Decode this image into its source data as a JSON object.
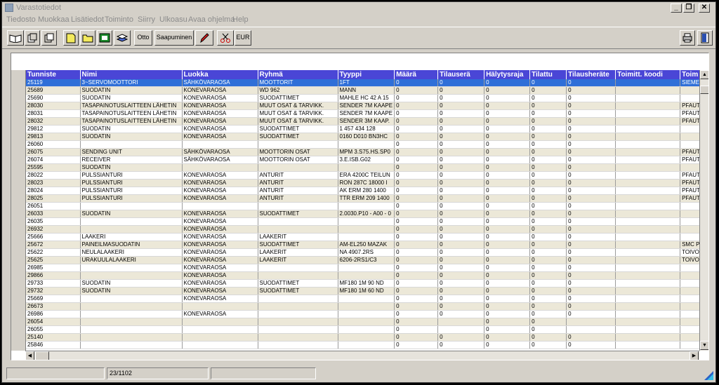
{
  "window": {
    "title": "Varastotiedot"
  },
  "title_buttons": [
    "minimize",
    "restore",
    "close"
  ],
  "menu": [
    "Tiedosto",
    "Muokkaa",
    "Lisätiedot",
    "Toiminto",
    "Siirry",
    "Ulkoasu",
    "Avaa ohjelma",
    "Help"
  ],
  "toolbar": {
    "otto_label": "Otto",
    "saapuminen_label": "Saapuminen",
    "eur_label": "EUR",
    "icons": [
      "open-book-icon",
      "copy-record-icon",
      "paste-record-icon",
      "yellow-folder-icon",
      "open-folder-icon",
      "green-chart-icon",
      "stacked-books-icon",
      "pencil-icon",
      "scissors-icon",
      "printer-icon",
      "exit-door-icon"
    ]
  },
  "grid": {
    "columns": [
      "Tunniste",
      "Nimi",
      "Luokka",
      "Ryhmä",
      "Tyyppi",
      "Määrä",
      "Tilauserä",
      "Hälytysraja",
      "Tilattu",
      "Tilausheräte",
      "Toimitt. koodi",
      "Toim"
    ],
    "selected_row": 0,
    "rows": [
      [
        "25119",
        "3~SERVOMOOTTORI",
        "SÄHKÖVARAOSA",
        "MOOTTORIT",
        "1FT",
        "0",
        "0",
        "0",
        "0",
        "0",
        "",
        "SIEMEN"
      ],
      [
        "25689",
        "SUODATIN",
        "KONEVARAOSA",
        "WD 962",
        "MANN",
        "0",
        "0",
        "0",
        "0",
        "0",
        "",
        ""
      ],
      [
        "25690",
        "SUODATIN",
        "KONEVARAOSA",
        "SUODATTIMET",
        "MAHLE HC 42 A 15",
        "0",
        "0",
        "0",
        "0",
        "0",
        "",
        ""
      ],
      [
        "28030",
        "TASAPAINOTUSLAITTEEN LÄHETIN",
        "KONEVARAOSA",
        "MUUT OSAT & TARVIKK.",
        "SENDER 7M KAAPE",
        "0",
        "0",
        "0",
        "0",
        "0",
        "",
        "PFAUTE"
      ],
      [
        "28031",
        "TASAPAINOTUSLAITTEEN LÄHETIN",
        "KONEVARAOSA",
        "MUUT OSAT & TARVIKK.",
        "SENDER 7M KAAPE",
        "0",
        "0",
        "0",
        "0",
        "0",
        "",
        "PFAUTE"
      ],
      [
        "28032",
        "TASAPAINOTUSLAITTEEN LÄHETIN",
        "KONEVARAOSA",
        "MUUT OSAT & TARVIKK.",
        "SENDER 3M KAAP.",
        "0",
        "0",
        "0",
        "0",
        "0",
        "",
        "PFAUTE"
      ],
      [
        "29812",
        "SUODATIN",
        "KONEVARAOSA",
        "SUODATTIMET",
        "1 457 434 128",
        "0",
        "0",
        "0",
        "0",
        "0",
        "",
        ""
      ],
      [
        "29813",
        "SUODATIN",
        "KONEVARAOSA",
        "SUODATTIMET",
        "0160 D010 BN3HC",
        "0",
        "0",
        "0",
        "0",
        "0",
        "",
        ""
      ],
      [
        "26060",
        "",
        "",
        "",
        "",
        "0",
        "0",
        "0",
        "0",
        "0",
        "",
        ""
      ],
      [
        "26075",
        "SENDING UNIT",
        "SÄHKÖVARAOSA",
        "MOOTTORIN OSAT",
        "MPM 3.S75.HS.SP0",
        "0",
        "0",
        "0",
        "0",
        "0",
        "",
        "PFAUTE"
      ],
      [
        "26074",
        "RECEIVER",
        "SÄHKÖVARAOSA",
        "MOOTTORIN OSAT",
        "3.E.ISB.G02",
        "0",
        "0",
        "0",
        "0",
        "0",
        "",
        "PFAUTE"
      ],
      [
        "25595",
        "SUODATIN",
        "",
        "",
        "",
        "0",
        "0",
        "0",
        "0",
        "0",
        "",
        ""
      ],
      [
        "28022",
        "PULSSIANTURI",
        "KONEVARAOSA",
        "ANTURIT",
        "ERA 4200C TEILUN",
        "0",
        "0",
        "0",
        "0",
        "0",
        "",
        "PFAUTI"
      ],
      [
        "28023",
        "PULSSIANTURI",
        "KONEVARAOSA",
        "ANTURIT",
        "RON 287C 18000 I",
        "0",
        "0",
        "0",
        "0",
        "0",
        "",
        "PFAUTE"
      ],
      [
        "28024",
        "PULSSIANTURI",
        "KONEVARAOSA",
        "ANTURIT",
        "AK ERM 280 1400",
        "0",
        "0",
        "0",
        "0",
        "0",
        "",
        "PFAUTE"
      ],
      [
        "28025",
        "PULSSIANTURI",
        "KONEVARAOSA",
        "ANTURIT",
        "TTR ERM 209 1400",
        "0",
        "0",
        "0",
        "0",
        "0",
        "",
        "PFAUTE"
      ],
      [
        "26051",
        "",
        "",
        "",
        "",
        "0",
        "0",
        "0",
        "0",
        "0",
        "",
        ""
      ],
      [
        "26033",
        "SUODATIN",
        "KONEVARAOSA",
        "SUODATTIMET",
        "2.0030.P10 - A00 - 0",
        "0",
        "0",
        "0",
        "0",
        "0",
        "",
        ""
      ],
      [
        "26035",
        "",
        "KONEVARAOSA",
        "",
        "",
        "0",
        "0",
        "0",
        "0",
        "0",
        "",
        ""
      ],
      [
        "26932",
        "",
        "KONEVARAOSA",
        "",
        "",
        "0",
        "0",
        "0",
        "0",
        "0",
        "",
        ""
      ],
      [
        "25666",
        "LAAKERI",
        "KONEVARAOSA",
        "LAAKERIT",
        "",
        "0",
        "0",
        "0",
        "0",
        "0",
        "",
        ""
      ],
      [
        "25672",
        "PAINEILMASUODATIN",
        "KONEVARAOSA",
        "SUODATTIMET",
        "AM-EL250 MAZAK",
        "0",
        "0",
        "0",
        "0",
        "0",
        "",
        "SMC PN"
      ],
      [
        "25622",
        "NEULALAAKERI",
        "KONEVARAOSA",
        "LAAKERIT",
        "NA 4907.2RS",
        "0",
        "0",
        "0",
        "0",
        "0",
        "",
        "TOIVOL"
      ],
      [
        "25625",
        "URAKUULALAAKERI",
        "KONEVARAOSA",
        "LAAKERIT",
        "6206-2RS1/C3",
        "0",
        "0",
        "0",
        "0",
        "0",
        "",
        "TOIVOL"
      ],
      [
        "26985",
        "",
        "KONEVARAOSA",
        "",
        "",
        "0",
        "0",
        "0",
        "0",
        "0",
        "",
        ""
      ],
      [
        "29866",
        "",
        "KONEVARAOSA",
        "",
        "",
        "0",
        "0",
        "0",
        "0",
        "0",
        "",
        ""
      ],
      [
        "29733",
        "SUODATIN",
        "KONEVARAOSA",
        "SUODATTIMET",
        "MF180 1M 90 ND",
        "0",
        "0",
        "0",
        "0",
        "0",
        "",
        ""
      ],
      [
        "29732",
        "SUODATIN",
        "KONEVARAOSA",
        "SUODATTIMET",
        "MF180 1M 60 ND",
        "0",
        "0",
        "0",
        "0",
        "0",
        "",
        ""
      ],
      [
        "25669",
        "",
        "KONEVARAOSA",
        "",
        "",
        "0",
        "0",
        "0",
        "0",
        "0",
        "",
        ""
      ],
      [
        "26673",
        "",
        "",
        "",
        "",
        "0",
        "0",
        "0",
        "0",
        "0",
        "",
        ""
      ],
      [
        "26986",
        "",
        "KONEVARAOSA",
        "",
        "",
        "0",
        "0",
        "0",
        "0",
        "0",
        "",
        ""
      ],
      [
        "26054",
        "",
        "",
        "",
        "",
        "0",
        "",
        "0",
        "0",
        "",
        "",
        ""
      ],
      [
        "26055",
        "",
        "",
        "",
        "",
        "0",
        "",
        "0",
        "0",
        "",
        "",
        ""
      ],
      [
        "25140",
        "",
        "",
        "",
        "",
        "0",
        "0",
        "0",
        "0",
        "0",
        "",
        ""
      ],
      [
        "25846",
        "",
        "",
        "",
        "",
        "0",
        "0",
        "0",
        "0",
        "0",
        "",
        ""
      ]
    ]
  },
  "status": {
    "record_position": "23/1102"
  }
}
